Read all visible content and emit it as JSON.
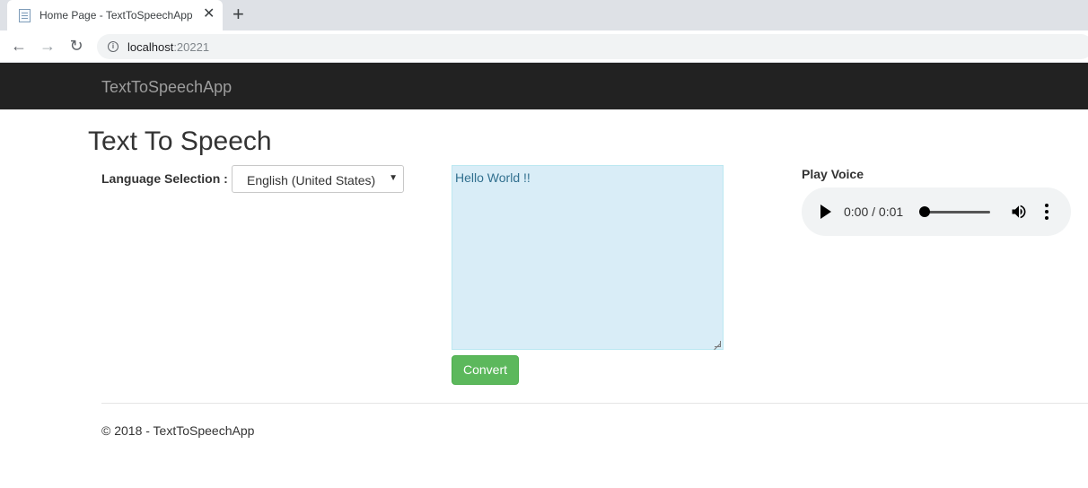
{
  "browser": {
    "tab_title": "Home Page - TextToSpeechApp",
    "tab_close": "✕",
    "new_tab": "+",
    "url_host": "localhost",
    "url_port": ":20221",
    "icons": [
      "back-icon",
      "forward-icon",
      "reload-icon",
      "info-icon",
      "close-icon",
      "plus-icon",
      "page-icon"
    ]
  },
  "navbar": {
    "brand": "TextToSpeechApp",
    "background": "#222222"
  },
  "main": {
    "title": "Text To Speech",
    "language_label": "Language Selection :",
    "language_selected": "English (United States)",
    "text_value": "Hello World !!",
    "textarea_color": "#d9edf7",
    "convert_label": "Convert",
    "convert_color": "#5cb85c",
    "play_label": "Play Voice"
  },
  "audio": {
    "time": "0:00 / 0:01",
    "progress": 0,
    "icons": [
      "play-icon",
      "volume-icon",
      "more-options-icon"
    ]
  },
  "footer": {
    "text": "© 2018 - TextToSpeechApp"
  }
}
